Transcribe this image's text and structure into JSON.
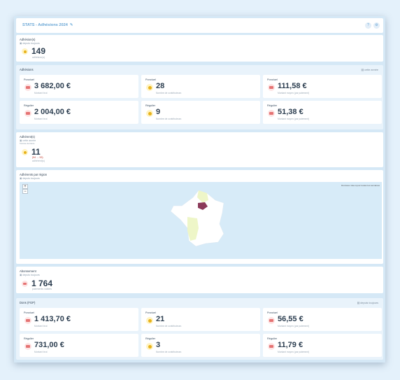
{
  "header": {
    "title": "STATS - Adhésions 2024",
    "edit_icon": "pencil-icon",
    "buttons": [
      "help-icon",
      "settings-icon"
    ]
  },
  "adhesions_total": {
    "title": "Adhésion(s)",
    "meta": "depuis toujours",
    "value": "149",
    "sub": "adhésion(s)"
  },
  "adhesions": {
    "title": "Adhésions",
    "period": "cette année",
    "stats": [
      {
        "label": "Ponctuel",
        "value": "3 682,00 €",
        "sub": "Montant brut",
        "icon": "card-icon"
      },
      {
        "label": "Ponctuel",
        "value": "28",
        "sub": "Nombre de contributeurs",
        "icon": "smiley-icon"
      },
      {
        "label": "Ponctuel",
        "value": "111,58 €",
        "sub": "Montant moyen (par paiement)",
        "icon": "card-icon"
      },
      {
        "label": "Régulier",
        "value": "2 004,00 €",
        "sub": "Montant brut",
        "icon": "card-icon"
      },
      {
        "label": "Régulier",
        "value": "9",
        "sub": "Nombre de contributeurs",
        "icon": "smiley-icon"
      },
      {
        "label": "Régulier",
        "value": "51,38 €",
        "sub": "Montant moyen (par paiement)",
        "icon": "card-icon"
      }
    ]
  },
  "adherents": {
    "title": "Adhérent(s)",
    "meta1": "cette année",
    "meta2": "l'année dernière",
    "value": "11",
    "delta": "(54 → 53)",
    "sub": "adhérent(s)"
  },
  "map": {
    "title": "Adhérents par région",
    "meta": "depuis toujours",
    "zoom_in": "+",
    "zoom_out": "−",
    "link": "Données mise à jour toutes les semaines"
  },
  "abonnement": {
    "title": "Abonnement",
    "meta": "depuis toujours",
    "value": "1 764",
    "sub": "paiements validés"
  },
  "dons": {
    "title": "Dons (FGP)",
    "period": "depuis toujours",
    "stats": [
      {
        "label": "Ponctuel",
        "value": "1 413,70 €",
        "sub": "Montant brut",
        "icon": "card-icon"
      },
      {
        "label": "Ponctuel",
        "value": "21",
        "sub": "Nombre de contributeurs",
        "icon": "smiley-icon"
      },
      {
        "label": "Ponctuel",
        "value": "56,55 €",
        "sub": "Montant moyen (par paiement)",
        "icon": "card-icon"
      },
      {
        "label": "Régulier",
        "value": "731,00 €",
        "sub": "Montant brut",
        "icon": "card-icon"
      },
      {
        "label": "Régulier",
        "value": "3",
        "sub": "Nombre de contributeurs",
        "icon": "smiley-icon"
      },
      {
        "label": "Régulier",
        "value": "11,79 €",
        "sub": "Montant moyen (par paiement)",
        "icon": "card-icon"
      }
    ]
  },
  "colors": {
    "accent": "#6aa7d6",
    "highlight_region": "#8b3a5a",
    "pale_region": "#eef6c8",
    "card_icon": "#e57373",
    "smiley_icon": "#e8b21a"
  }
}
